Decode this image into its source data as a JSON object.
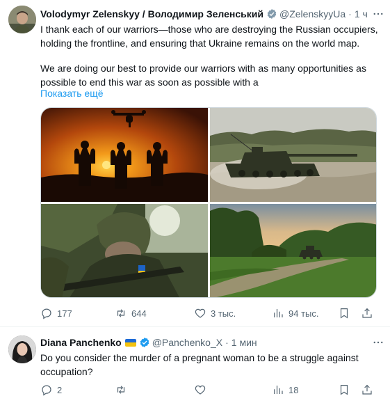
{
  "main_tweet": {
    "display_name": "Volodymyr Zelenskyy / Володимир Зеленський",
    "handle": "@ZelenskyyUa",
    "time": "1 ч",
    "text_line1": "I thank each of our warriors—those who are destroying the Russian occupiers, holding the frontline, and ensuring that Ukraine remains on the world map.",
    "text_line2": "We are doing our best to provide our warriors with as many opportunities as possible to end this war as soon as possible with a",
    "show_more": "Показать ещё",
    "replies": "177",
    "retweets": "644",
    "likes": "3 тыс.",
    "views": "94 тыс."
  },
  "reply_tweet": {
    "display_name": "Diana Panchenko",
    "handle": "@Panchenko_X",
    "time": "1 мин",
    "text": "Do you consider the murder of a pregnant woman to be a struggle against occupation?",
    "replies": "2",
    "retweets": "",
    "likes": "",
    "views": "18"
  },
  "colors": {
    "accent": "#1d9bf0",
    "secondary_text": "#536471",
    "verified_badge": "#829aab"
  },
  "dot": "·"
}
